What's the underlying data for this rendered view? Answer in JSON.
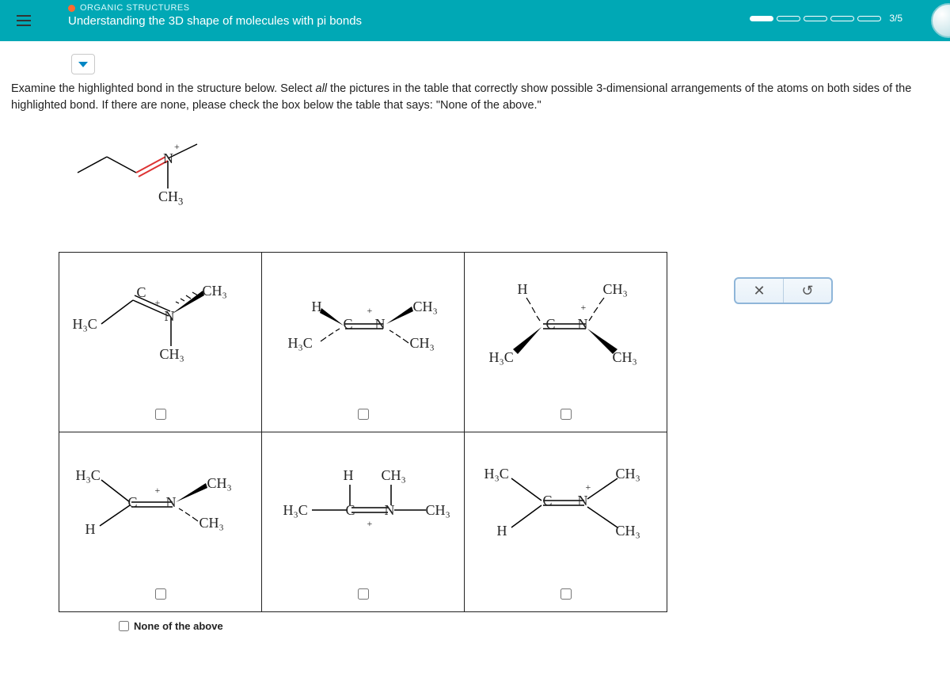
{
  "header": {
    "subject": "ORGANIC STRUCTURES",
    "lesson": "Understanding the 3D shape of molecules with pi bonds",
    "progress_text": "3/5"
  },
  "question": {
    "part1": "Examine the highlighted bond in the structure below. Select ",
    "emph": "all",
    "part2": " the pictures in the table that correctly show possible 3-dimensional arrangements of the atoms on both sides of the highlighted bond. If there are none, please check the box below the table that says: \"None of the above.\""
  },
  "reference_labels": {
    "n": "N",
    "ch3": "CH",
    "sub3": "3",
    "plus": "+"
  },
  "chem": {
    "H3C": "H₃C",
    "CH3": "CH₃",
    "H": "H",
    "C": "C",
    "N": "N",
    "CeqN": "C=N",
    "plus": "+"
  },
  "none_label": "None of the above",
  "buttons": {
    "close": "✕",
    "reset": "↺"
  }
}
